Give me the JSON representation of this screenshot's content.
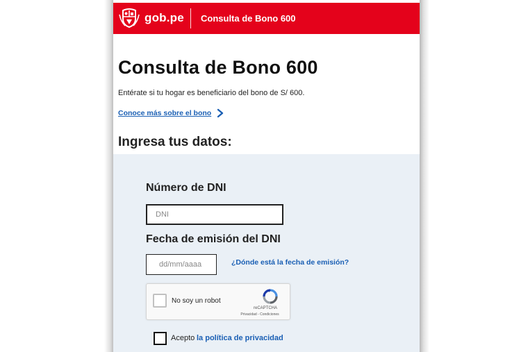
{
  "header": {
    "brand": "gob.pe",
    "section": "Consulta de Bono 600"
  },
  "main": {
    "title": "Consulta de Bono 600",
    "subtitle": "Entérate si tu hogar es beneficiario del bono de S/ 600.",
    "learn_more": "Conoce más sobre el bono",
    "section_title": "Ingresa tus datos:"
  },
  "form": {
    "dni_label": "Número de DNI",
    "dni_placeholder": "DNI",
    "date_label": "Fecha de emisión del DNI",
    "date_placeholder": "dd/mm/aaaa",
    "where_link": "¿Dónde está la fecha de emisión?",
    "recaptcha": {
      "label": "No soy un robot",
      "brand": "reCAPTCHA",
      "terms": "Privacidad - Condiciones"
    },
    "accept_prefix": "Acepto",
    "privacy_link": "la política de privacidad"
  },
  "colors": {
    "header_red": "#e4021b",
    "link_blue": "#1a5fb4",
    "panel_bg": "#eaf0f6"
  },
  "icons": {
    "logo": "peru-coat-of-arms-icon",
    "chevron": "chevron-right-icon",
    "captcha": "recaptcha-logo-icon"
  }
}
